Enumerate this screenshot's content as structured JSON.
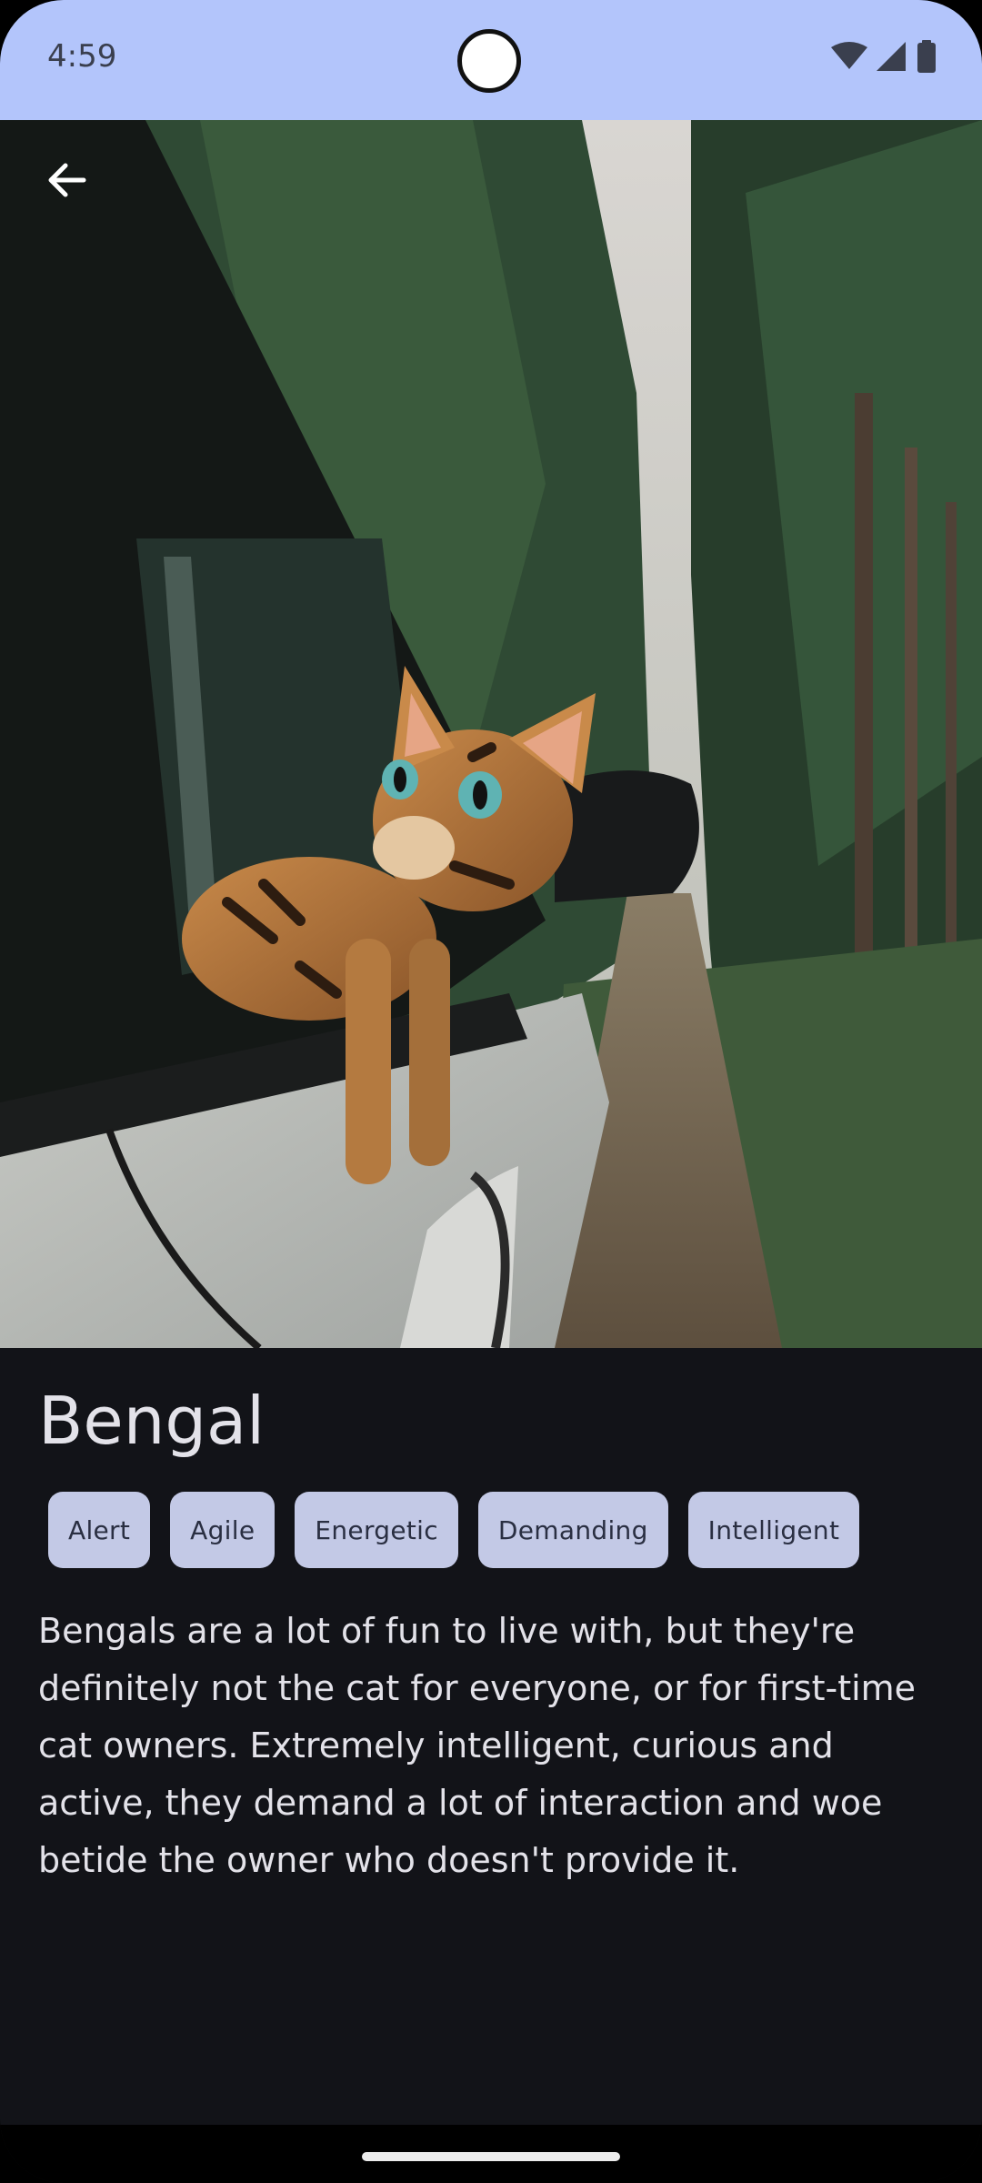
{
  "status_bar": {
    "time": "4:59",
    "icons": [
      "wifi-icon",
      "signal-icon",
      "battery-icon"
    ]
  },
  "hero_image": {
    "description_icon": "cat-photo"
  },
  "navigation": {
    "back_icon": "arrow-back-icon"
  },
  "breed": {
    "name": "Bengal",
    "temperament": [
      "Alert",
      "Agile",
      "Energetic",
      "Demanding",
      "Intelligent"
    ],
    "description": "Bengals are a lot of fun to live with, but they're definitely not the cat for everyone, or for first-time cat owners. Extremely intelligent, curious and active, they demand a lot of interaction and woe betide the owner who doesn't provide it."
  },
  "colors": {
    "status_bar_bg": "#b3c5fb",
    "page_bg": "#121318",
    "chip_bg": "#c3c9e6",
    "text_primary": "#e3e2e9"
  }
}
